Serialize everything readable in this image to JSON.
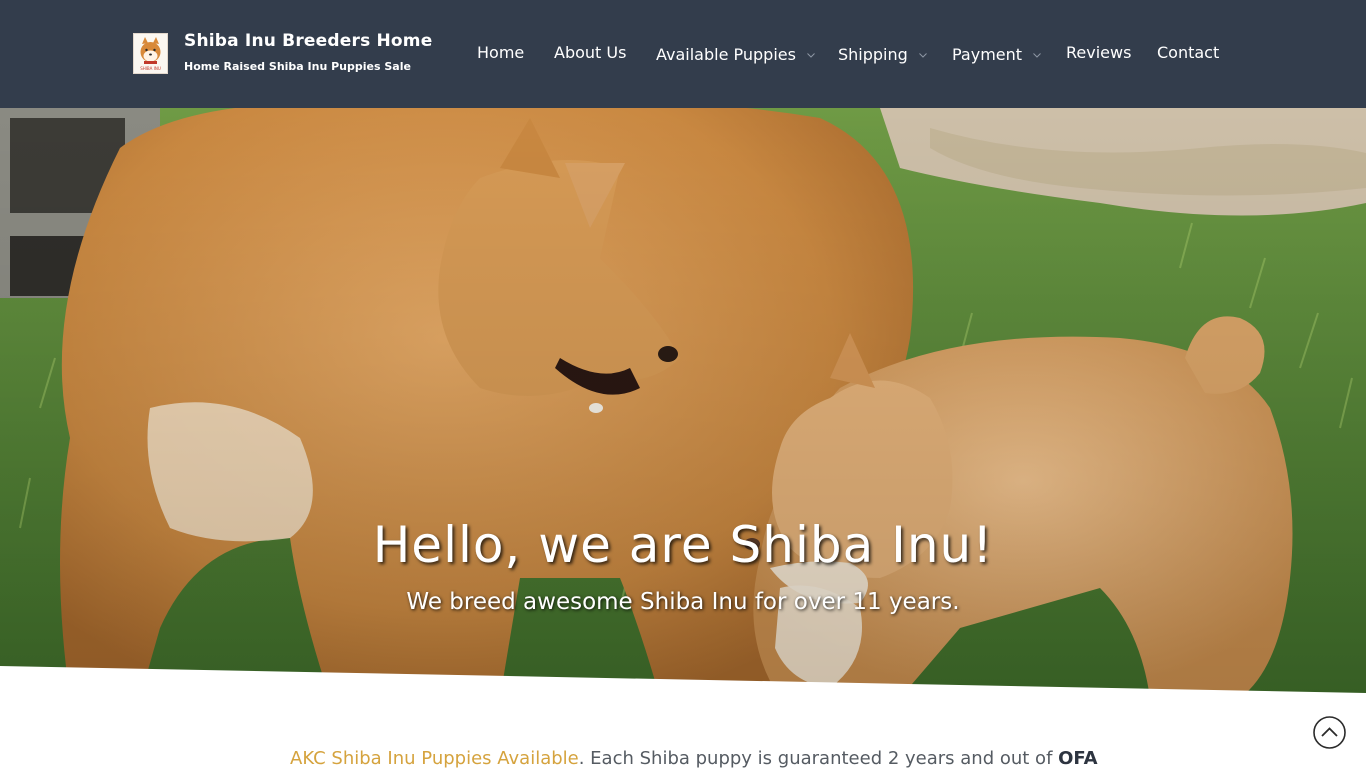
{
  "site": {
    "title": "Shiba Inu Breeders Home",
    "tagline": "Home Raised Shiba Inu Puppies Sale",
    "logo_caption": "SHIBA INU"
  },
  "nav": {
    "items": [
      {
        "label": "Home",
        "dropdown": false
      },
      {
        "label": "About Us",
        "dropdown": false
      },
      {
        "label": "Available Puppies",
        "dropdown": true
      },
      {
        "label": "Shipping",
        "dropdown": true
      },
      {
        "label": "Payment",
        "dropdown": true
      },
      {
        "label": "Reviews",
        "dropdown": false
      },
      {
        "label": "Contact",
        "dropdown": false
      }
    ]
  },
  "hero": {
    "title": "Hello, we are Shiba Inu!",
    "subtitle": "We breed awesome Shiba Inu for over 11 years."
  },
  "intro": {
    "link_text": "AKC Shiba Inu Puppies Available",
    "text": ". Each Shiba puppy is  guaranteed 2 years and out of ",
    "bold_text": "OFA"
  },
  "icons": {
    "dropdown": "chevron-down-icon",
    "scroll_top": "arrow-up-circle-icon"
  },
  "colors": {
    "header_bg": "#333d4c",
    "link": "#d5a33e",
    "text": "#555b62"
  }
}
